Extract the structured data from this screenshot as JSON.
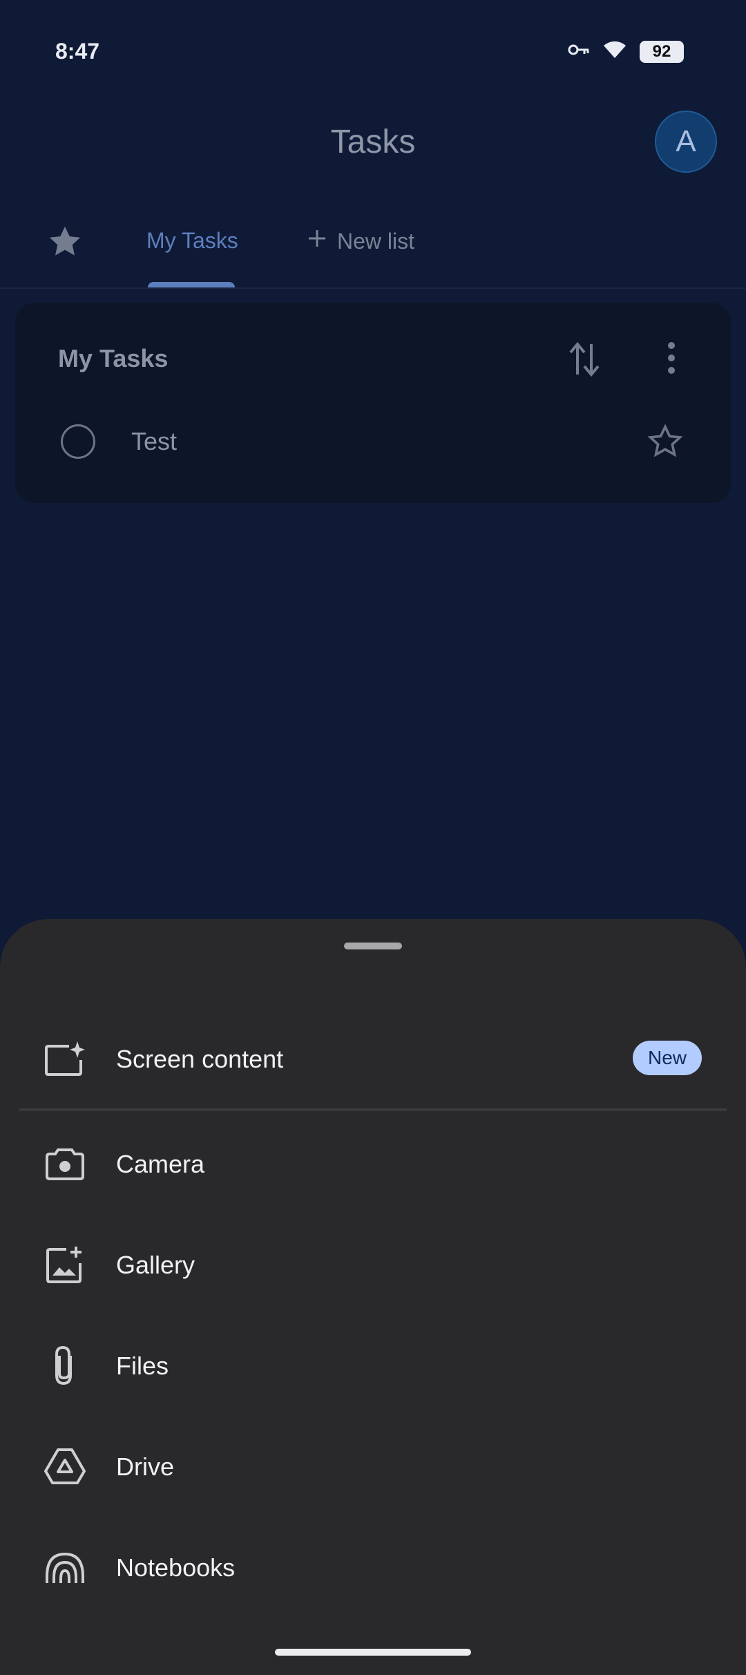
{
  "status_bar": {
    "time": "8:47",
    "battery": "92"
  },
  "app_bar": {
    "title": "Tasks",
    "avatar_letter": "A"
  },
  "tabs": {
    "active": "My Tasks",
    "new_list": "New list"
  },
  "task_list": {
    "title": "My Tasks",
    "tasks": [
      {
        "title": "Test",
        "completed": false,
        "starred": false
      }
    ]
  },
  "attach_sheet": {
    "items": [
      {
        "label": "Screen content",
        "icon": "screen-content-icon",
        "badge": "New"
      },
      {
        "label": "Camera",
        "icon": "camera-icon"
      },
      {
        "label": "Gallery",
        "icon": "gallery-icon"
      },
      {
        "label": "Files",
        "icon": "paperclip-icon"
      },
      {
        "label": "Drive",
        "icon": "drive-icon"
      },
      {
        "label": "Notebooks",
        "icon": "notebooks-icon"
      }
    ]
  },
  "colors": {
    "background": "#0f1a36",
    "card": "#0d1529",
    "accent": "#5c7fbe",
    "sheet": "#29292b",
    "badge": "#b3ccff"
  }
}
